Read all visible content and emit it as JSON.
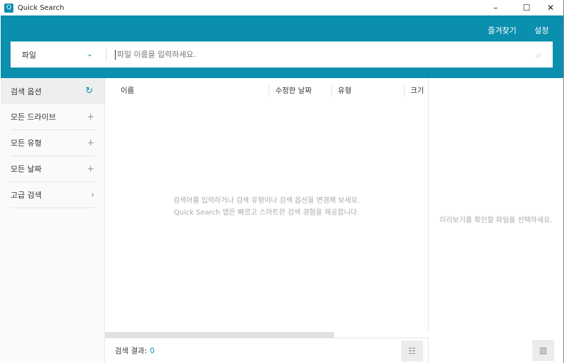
{
  "window": {
    "title": "Quick Search",
    "minimize": "–",
    "maximize": "☐",
    "close": "✕"
  },
  "header": {
    "favorites": "즐겨찾기",
    "settings": "설정"
  },
  "search": {
    "scope": "파일",
    "placeholder": "파일 이름을 입력하세요."
  },
  "sidebar": {
    "items": [
      {
        "label": "검색 옵션",
        "icon": "↻"
      },
      {
        "label": "모든 드라이브",
        "icon": "+"
      },
      {
        "label": "모든 유형",
        "icon": "+"
      },
      {
        "label": "모든 날짜",
        "icon": "+"
      },
      {
        "label": "고급 검색",
        "icon": "›"
      }
    ]
  },
  "columns": [
    "이름",
    "수정한 날짜",
    "유형",
    "크기"
  ],
  "empty": {
    "line1": "검색어를 입력하거나 검색 유형이나 검색 옵션을 변경해 보세요.",
    "line2": "Quick Search 앱은 빠르고 스마트한 검색 경험을 제공합니다."
  },
  "footer": {
    "label": "검색 결과:",
    "count": "0"
  },
  "preview": {
    "text": "미리보기를 확인할 파일을 선택하세요."
  }
}
